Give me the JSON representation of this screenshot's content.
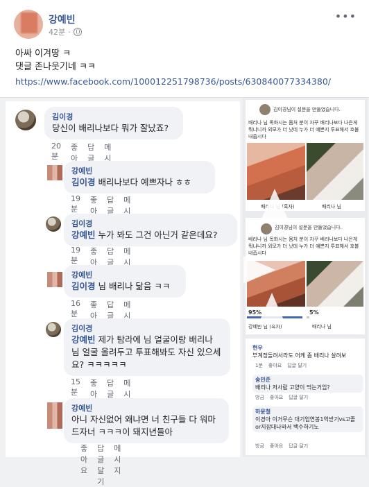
{
  "post": {
    "author": "강예빈",
    "time": "42분",
    "more_icon": "more-horizontal-icon",
    "line1": "아싸 이겨땅 ㅋ",
    "line2": "댓글 존나웃기네 ㅋㅋ",
    "link": "https://www.facebook.com/100012251798736/posts/630840077334380/"
  },
  "comments": [
    {
      "name": "김이경",
      "tag": "",
      "text": "당신이 배리나보다 뭐가 잘났죠?",
      "time": "20분",
      "like": "좋아요",
      "reply": "답글 달기",
      "message": "메시지"
    },
    {
      "name": "강예빈",
      "tag": "김이경",
      "text": " 배리나보다 예쁘자나 ㅎㅎ",
      "time": "19분",
      "like": "좋아요",
      "reply": "답글 달기",
      "message": "메시지"
    },
    {
      "name": "김이경",
      "tag": "강예빈",
      "text": " 누가 봐도 그건 아닌거 같은데요?",
      "time": "19분",
      "like": "좋아요",
      "reply": "답글 달기",
      "message": "메시지"
    },
    {
      "name": "강예빈",
      "tag": "김이경",
      "text": " 님 배리나 닮음 ㅋㅋ",
      "time": "16분",
      "like": "좋아요",
      "reply": "답글 달기",
      "message": "메시지"
    },
    {
      "name": "김이경",
      "tag": "강예빈",
      "text": " 제가 탐라에 님 얼굴이랑 배리나 님 얼굴 올려두고 투표해봐도 자신 있으세요? ㅋㅋㅋㅋㅋ",
      "time": "15분",
      "like": "좋아요",
      "reply": "답글 달기",
      "message": "메시지"
    },
    {
      "name": "강예빈",
      "tag": "",
      "text": "아니 자신없어 왜냐면 너 친구들 다 워마드자너 ㅋㅋㅋ이 돼지년들아",
      "time": "",
      "like": "좋아요",
      "reply": "답글 달기",
      "message": "메시지"
    }
  ],
  "right": {
    "poll1_header": "김이경님이 설문을 만들었습니다.",
    "poll1_body": "배리나 님 목화시는 몸처 분이 자꾸 배리나보다 나은게 뭐냐니까 외모가 더 낫데 누가 더 예쁜지 투표해서 호불 내줍시다",
    "poll1_left_label": "배리나 님 (흑자)",
    "poll1_right_label": "배리나 님",
    "poll2_header": "김이경님이 설문을 만들었습니다.",
    "poll2_body": "배리나 님 목화시는 몸처 분이 자꾸 배리나보다 나은게 뭐냐니까 외모가 더 낫데 누가 더 예쁜지 투표해서 호불 내줍시다",
    "poll2_left_pct": "95%",
    "poll2_right_pct": "5%",
    "poll2_left_label": "강예빈 님 (흑자)",
    "poll2_right_label": "배리나 님",
    "poll2_left_value": 95,
    "poll2_right_value": 5,
    "rc1_name": "현우",
    "rc1_text": "부계정돌려서라도 어케 좀 배리나 살려보",
    "rc1_time": "1분",
    "rc2_name": "송민준",
    "rc2_text": "배리나 저사람 고양이 먹는거임?",
    "rc2_time": "방금",
    "rc3_name": "하윤철",
    "rc3_text": "이경아 이거무슨 대기업연봉1억받기vs고졸 or지잡대나와서 백수하기노",
    "rc3_time": "방금",
    "like": "좋아요",
    "reply": "답글 달기"
  }
}
